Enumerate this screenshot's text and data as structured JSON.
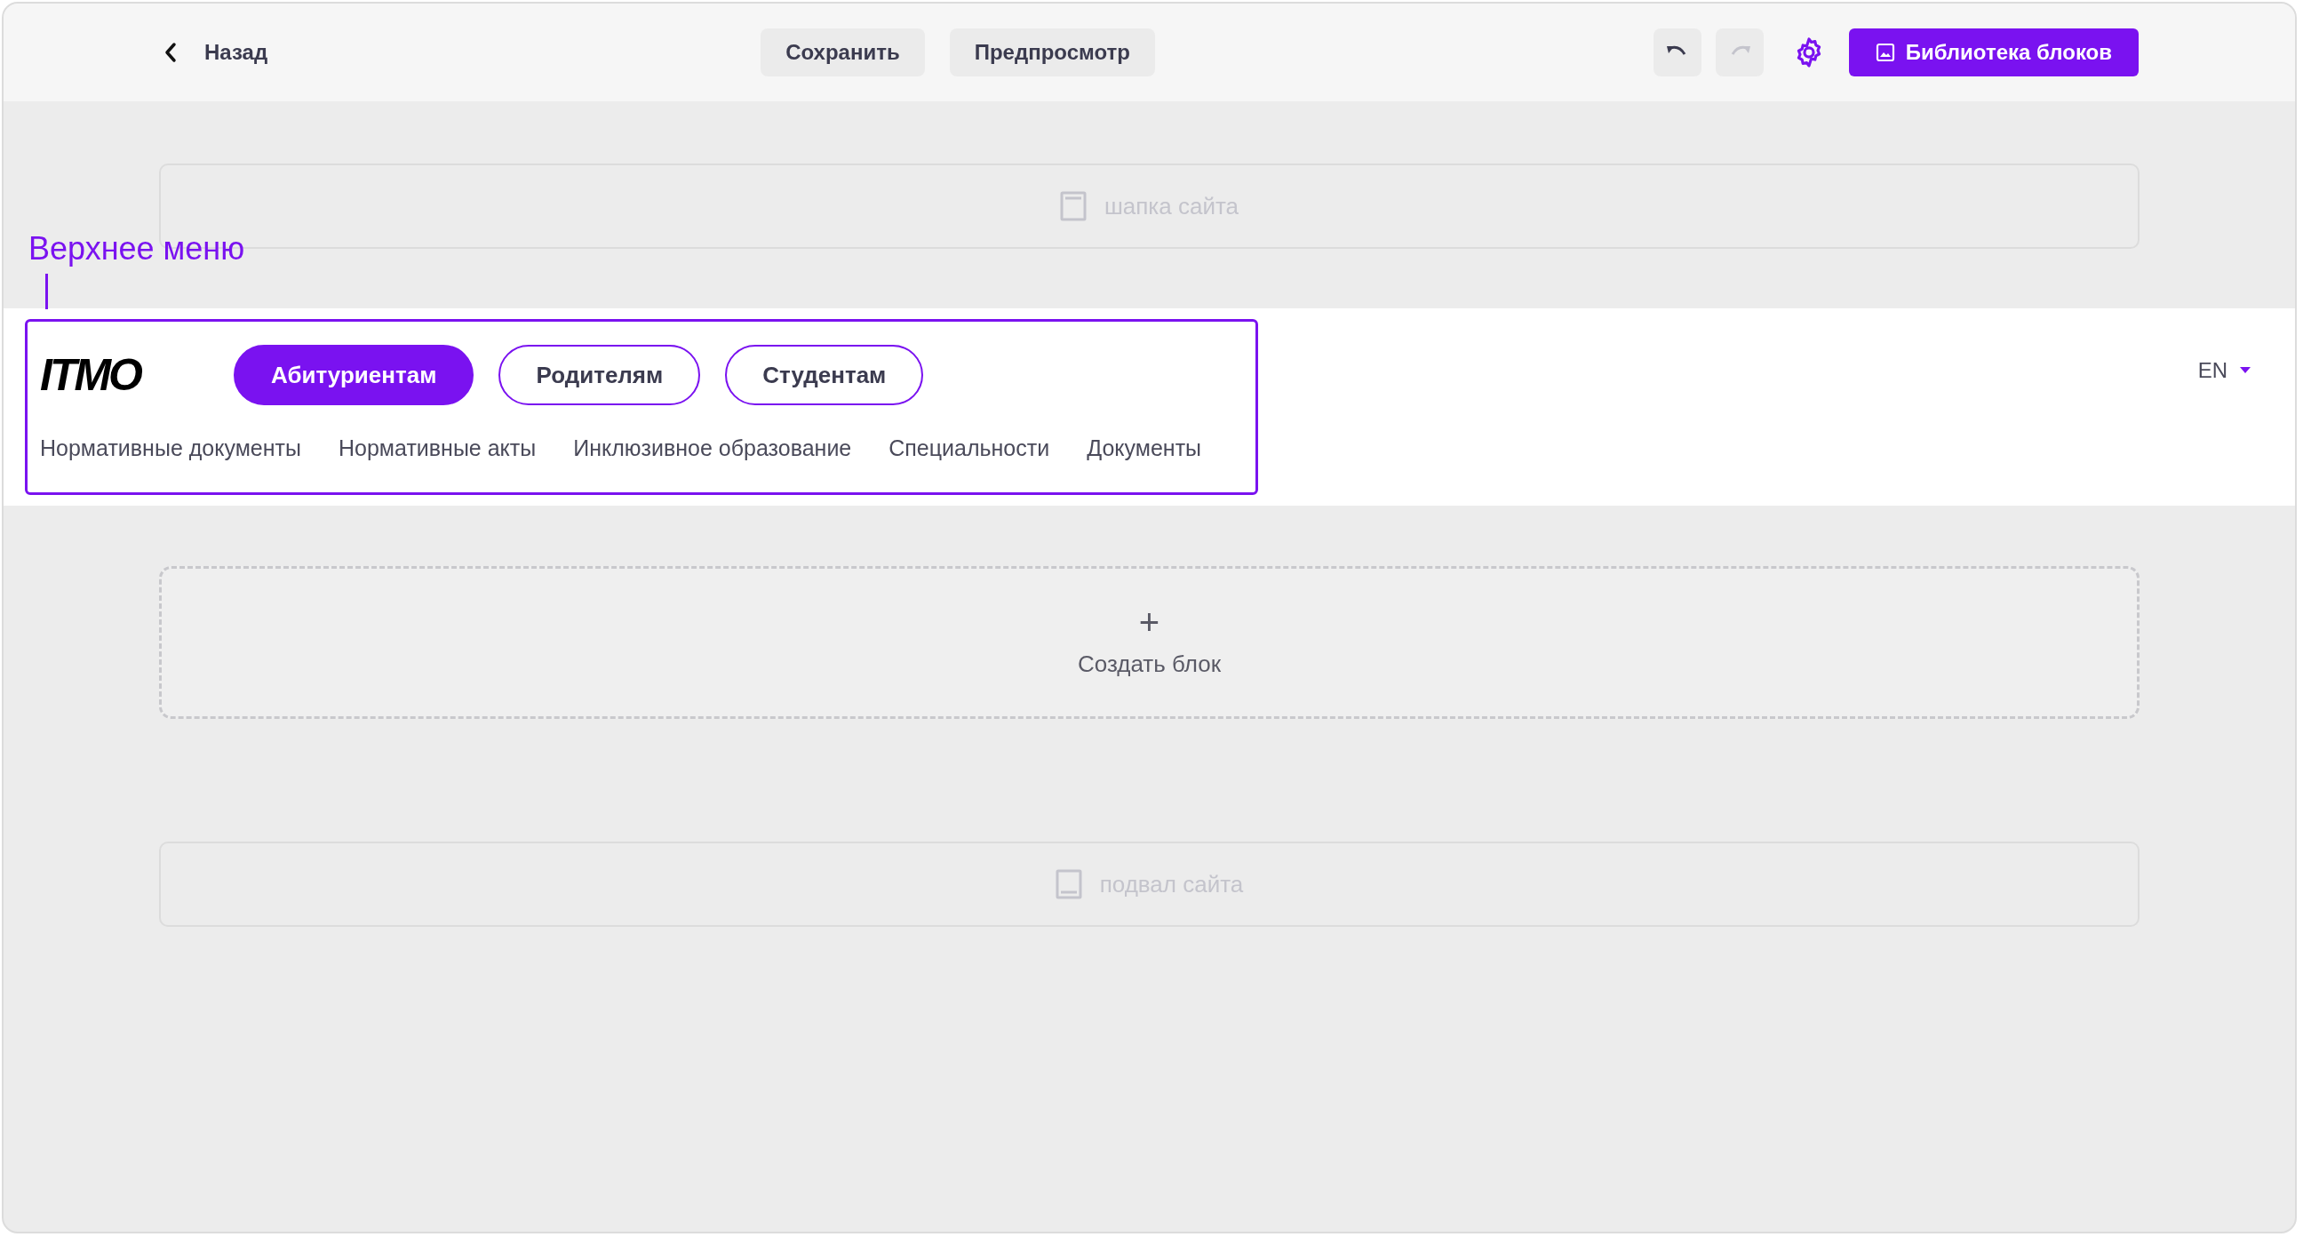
{
  "toolbar": {
    "back": "Назад",
    "buttons": [
      {
        "label": "Сохранить"
      },
      {
        "label": "Предпросмотр"
      }
    ],
    "undo": {
      "disabled": false
    },
    "redo": {
      "disabled": true
    },
    "library_button": "Библиотека блоков"
  },
  "header_placeholder": "шапка сайта",
  "selection_label": "Верхнее меню",
  "top_menu": {
    "logo": "ITMO",
    "tabs": [
      {
        "label": "Абитуриентам",
        "selected": true
      },
      {
        "label": "Родителям",
        "selected": false
      },
      {
        "label": "Студентам",
        "selected": false
      }
    ],
    "links": [
      "Нормативные документы",
      "Нормативные акты",
      "Инклюзивное образование",
      "Специальности",
      "Документы"
    ],
    "language": "EN"
  },
  "create_block": {
    "icon": "+",
    "label": "Создать блок"
  },
  "footer_placeholder": "подвал сайта"
}
